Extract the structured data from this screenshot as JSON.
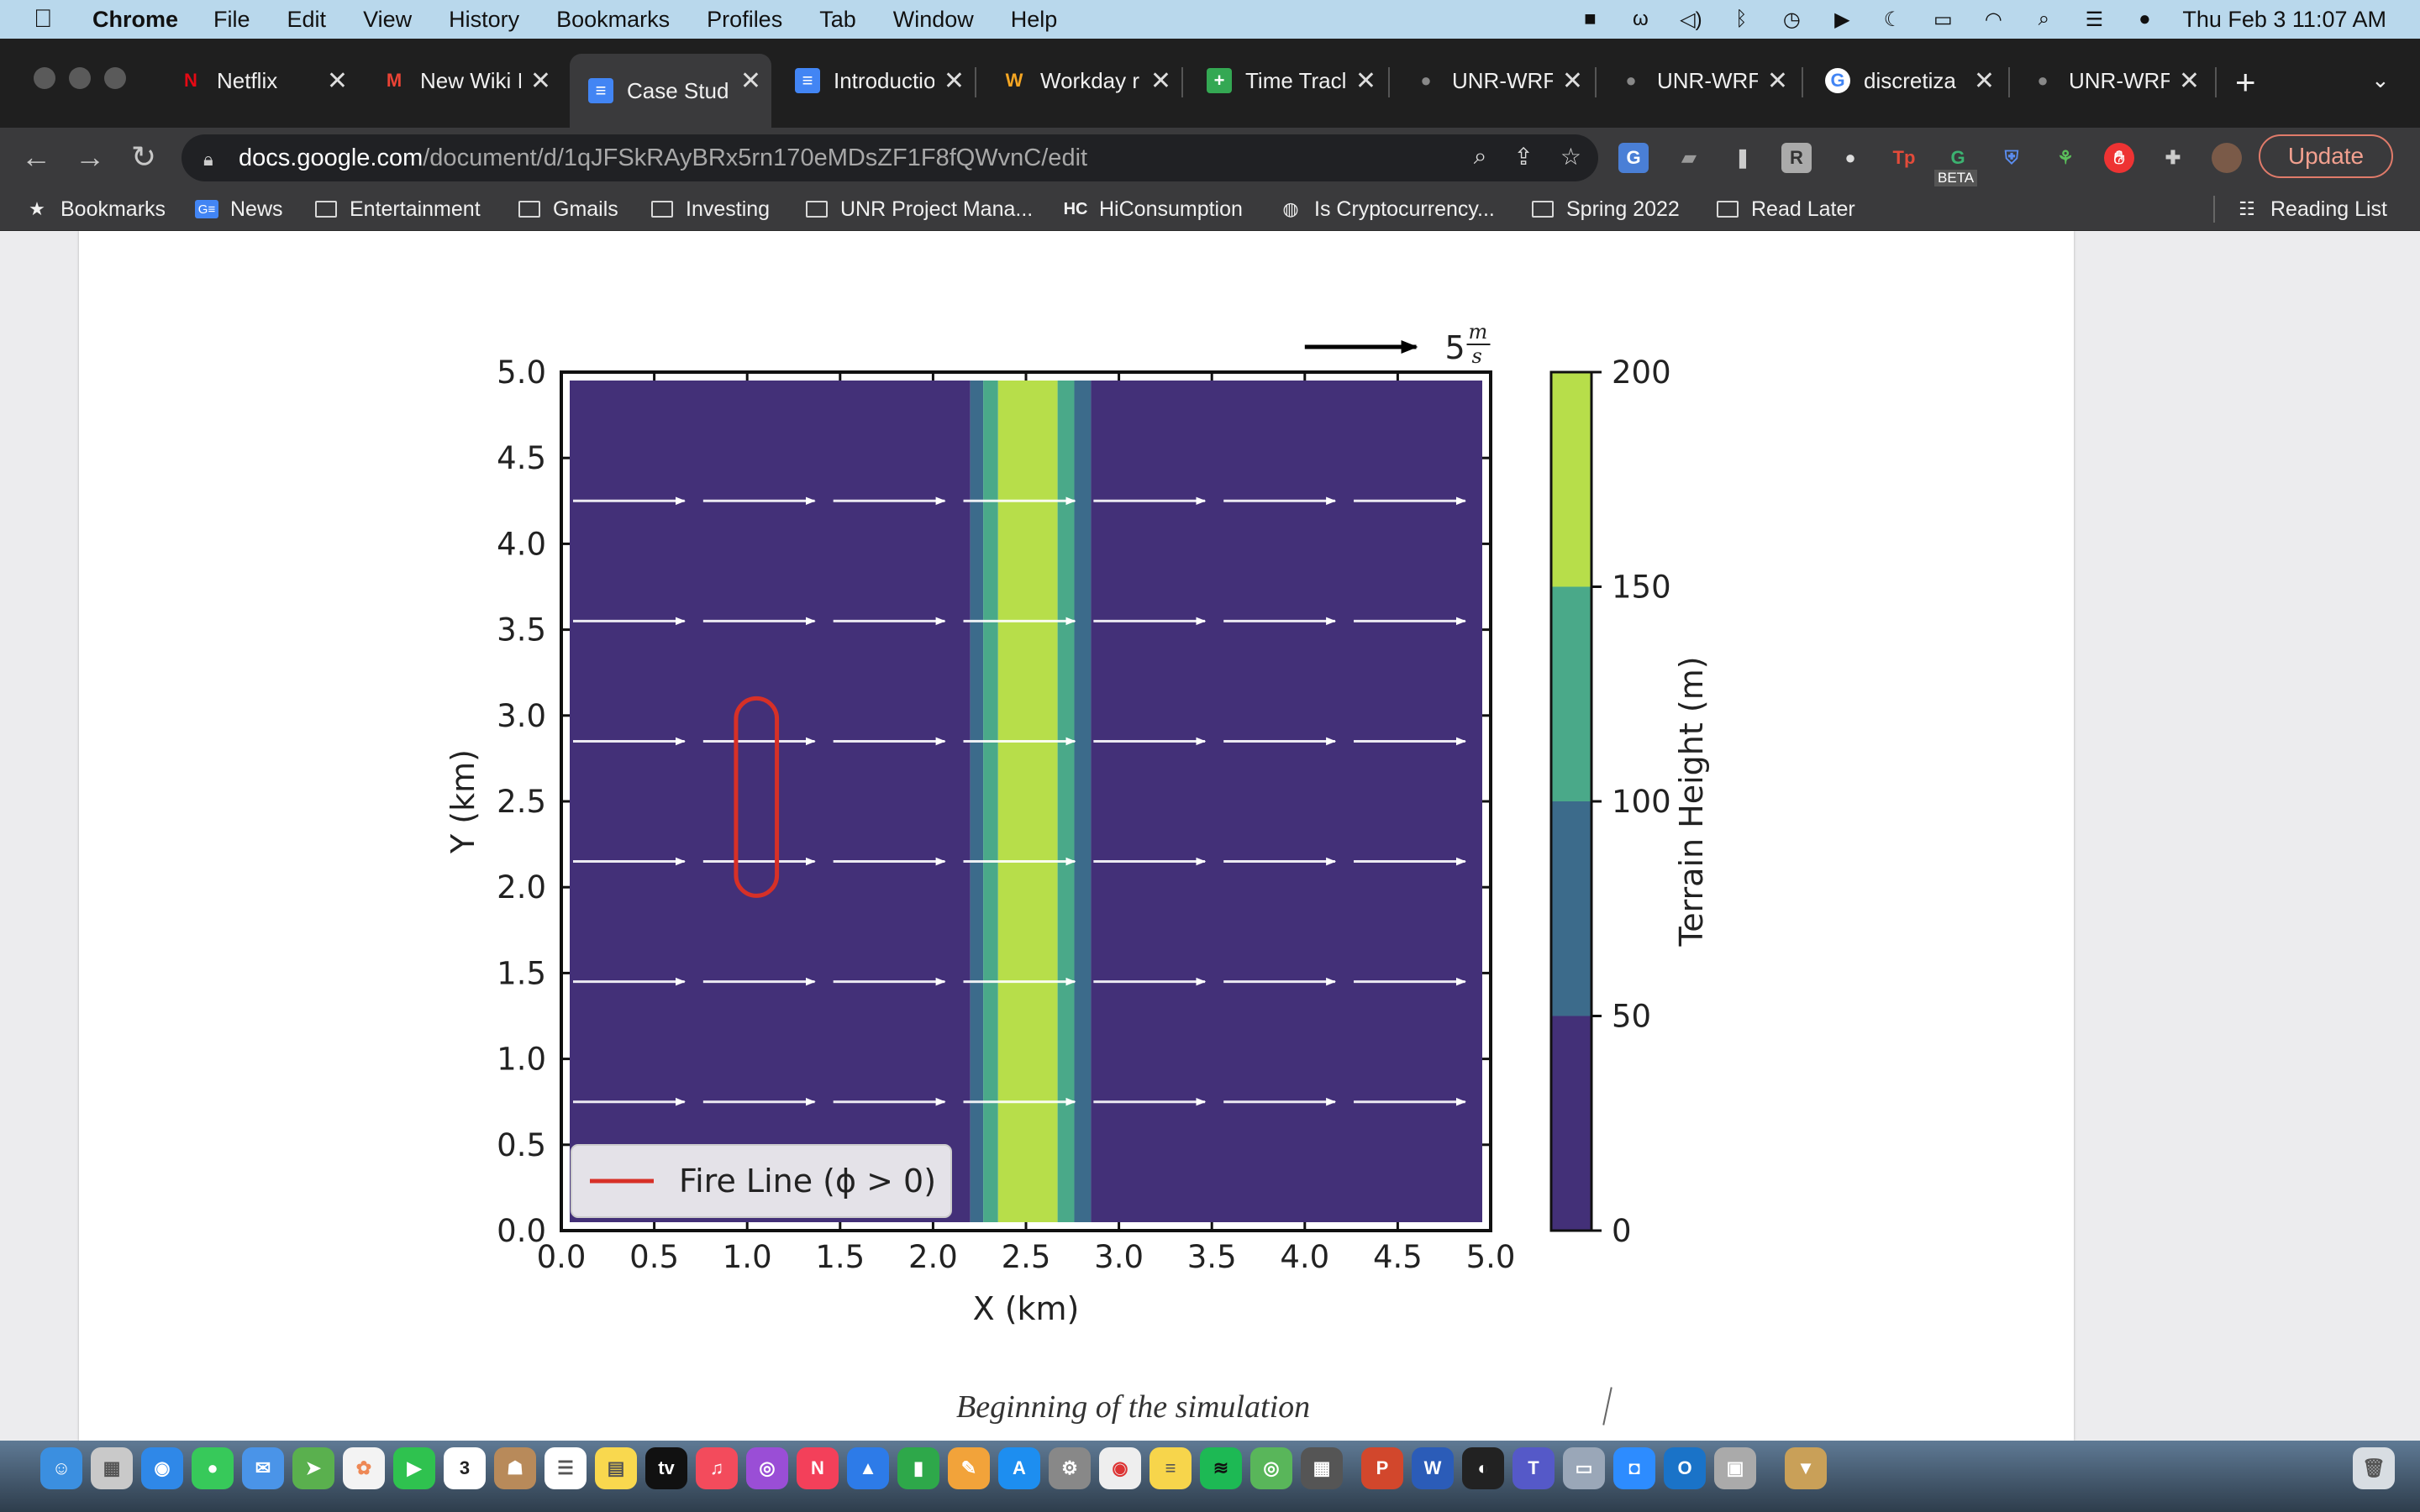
{
  "menubar": {
    "app_name": "Chrome",
    "items": [
      "File",
      "Edit",
      "View",
      "History",
      "Bookmarks",
      "Profiles",
      "Tab",
      "Window",
      "Help"
    ],
    "clock": "Thu Feb 3  11:07 AM"
  },
  "tabs": [
    {
      "title": "Netflix",
      "favicon": "netflix-icon",
      "color": "#e50914",
      "glyph": "N"
    },
    {
      "title": "New Wiki I",
      "favicon": "gmail-icon",
      "color": "#ea4335",
      "glyph": "M"
    },
    {
      "title": "Case Stud",
      "favicon": "google-docs-icon",
      "color": "#4285f4",
      "glyph": "≡",
      "active": true
    },
    {
      "title": "Introductio",
      "favicon": "google-docs-icon",
      "color": "#4285f4",
      "glyph": "≡"
    },
    {
      "title": "Workday r",
      "favicon": "workday-icon",
      "color": "#f5a623",
      "glyph": "W"
    },
    {
      "title": "Time Tracl",
      "favicon": "google-sheets-icon",
      "color": "#34a853",
      "glyph": "+"
    },
    {
      "title": "UNR-WRF",
      "favicon": "github-icon",
      "color": "#444444",
      "glyph": "●"
    },
    {
      "title": "UNR-WRF",
      "favicon": "github-icon",
      "color": "#444444",
      "glyph": "●"
    },
    {
      "title": "discretiza",
      "favicon": "google-icon",
      "color": "#ffffff",
      "glyph": "G"
    },
    {
      "title": "UNR-WRF",
      "favicon": "github-icon",
      "color": "#444444",
      "glyph": "●"
    }
  ],
  "omnibox": {
    "domain": "docs.google.com",
    "path": "/document/d/1qJFSkRAyBRx5rn170eMDsZF1F8fQWvnC/edit"
  },
  "update_label": "Update",
  "extensions": {
    "beta_label": "BETA"
  },
  "bookmarks": {
    "items": [
      {
        "label": "Bookmarks",
        "icon": "star-icon"
      },
      {
        "label": "News",
        "icon": "google-news-icon"
      },
      {
        "label": "Entertainment",
        "icon": "folder-icon"
      },
      {
        "label": "Gmails",
        "icon": "folder-icon"
      },
      {
        "label": "Investing",
        "icon": "folder-icon"
      },
      {
        "label": "UNR Project Mana...",
        "icon": "folder-icon"
      },
      {
        "label": "HiConsumption",
        "icon": "hc-icon"
      },
      {
        "label": "Is Cryptocurrency...",
        "icon": "globe-icon"
      },
      {
        "label": "Spring 2022",
        "icon": "folder-icon"
      },
      {
        "label": "Read Later",
        "icon": "folder-icon"
      }
    ],
    "reading_list": "Reading List"
  },
  "document": {
    "caption": "Beginning of the simulation"
  },
  "chart_data": {
    "type": "heatmap",
    "xlabel": "X (km)",
    "ylabel": "Y (km)",
    "xlim": [
      0.0,
      5.0
    ],
    "ylim": [
      0.0,
      5.0
    ],
    "xticks": [
      "0.0",
      "0.5",
      "1.0",
      "1.5",
      "2.0",
      "2.5",
      "3.0",
      "3.5",
      "4.0",
      "4.5",
      "5.0"
    ],
    "yticks": [
      "0.0",
      "0.5",
      "1.0",
      "1.5",
      "2.0",
      "2.5",
      "3.0",
      "3.5",
      "4.0",
      "4.5",
      "5.0"
    ],
    "colorbar": {
      "label": "Terrain Height (m)",
      "ticks": [
        "0",
        "50",
        "100",
        "150",
        "200"
      ],
      "levels": [
        0,
        50,
        100,
        150,
        200
      ],
      "colors": [
        "#433078",
        "#3c6b8b",
        "#4aa989",
        "#b7de4a"
      ]
    },
    "terrain_bands": [
      {
        "x0": 0.0,
        "x1": 2.2,
        "level": 0
      },
      {
        "x0": 2.2,
        "x1": 2.27,
        "level": 1
      },
      {
        "x0": 2.27,
        "x1": 2.35,
        "level": 2
      },
      {
        "x0": 2.35,
        "x1": 2.67,
        "level": 3
      },
      {
        "x0": 2.67,
        "x1": 2.76,
        "level": 2
      },
      {
        "x0": 2.76,
        "x1": 2.85,
        "level": 1
      },
      {
        "x0": 2.85,
        "x1": 5.0,
        "level": 0
      }
    ],
    "wind": {
      "u_ms": 5,
      "v_ms": 0,
      "rows_y_km": [
        0.75,
        1.45,
        2.15,
        2.85,
        3.55,
        4.25
      ],
      "cols_x_km": [
        0.0,
        0.7,
        1.4,
        2.1,
        2.8,
        3.5,
        4.2
      ]
    },
    "quiver_key": {
      "label": "5",
      "unit_num": "m",
      "unit_den": "s"
    },
    "fire_line": {
      "x_km": 1.05,
      "y0_km": 1.95,
      "y1_km": 3.1,
      "width_km": 0.22,
      "color": "#d73027"
    },
    "legend": {
      "label": "Fire Line (ϕ > 0)",
      "position": "lower-left"
    }
  }
}
